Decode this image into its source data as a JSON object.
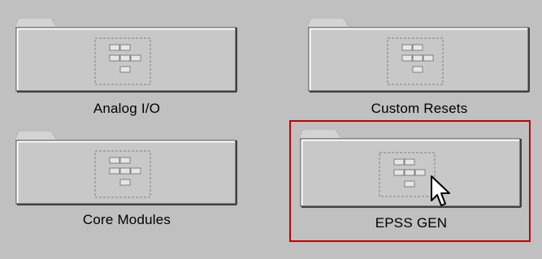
{
  "folders": [
    {
      "label": "Analog I/O",
      "icon": "module-diagram-icon"
    },
    {
      "label": "Custom Resets",
      "icon": "module-diagram-icon"
    },
    {
      "label": "Core Modules",
      "icon": "module-diagram-icon"
    },
    {
      "label": "EPSS GEN",
      "icon": "module-diagram-icon",
      "selected": true
    }
  ],
  "colors": {
    "background": "#c0c0c0",
    "folder_face": "#c8c8c8",
    "selection": "#c40000"
  }
}
